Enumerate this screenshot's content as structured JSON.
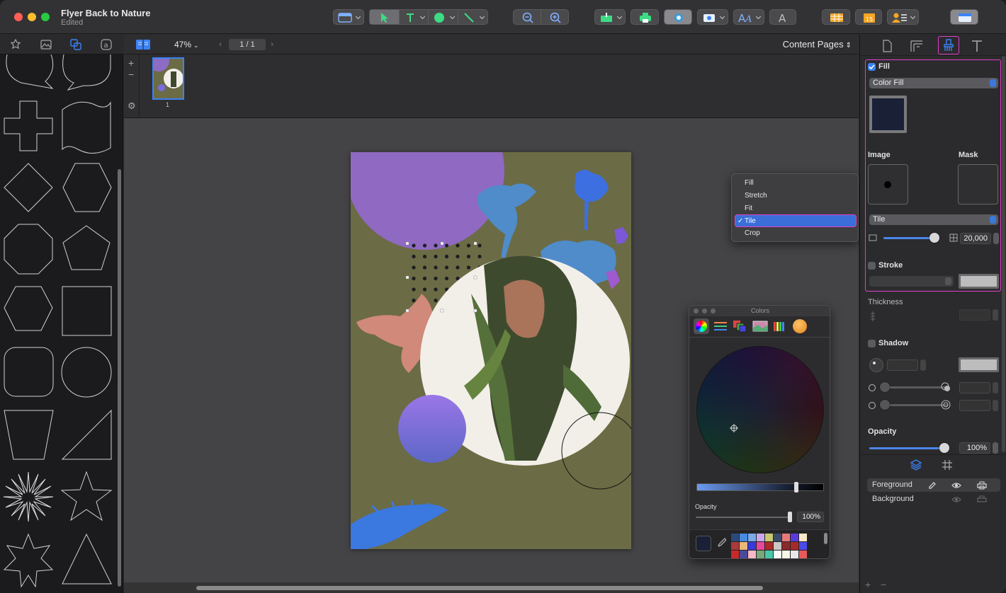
{
  "window": {
    "title": "Flyer Back to Nature",
    "subtitle": "Edited"
  },
  "navbar": {
    "zoom": "47%",
    "page_indicator": "1 / 1",
    "view_mode": "Content Pages"
  },
  "thumbnails": [
    {
      "label": "1"
    }
  ],
  "fit_menu": {
    "items": [
      "Fill",
      "Stretch",
      "Fit",
      "Tile",
      "Crop"
    ],
    "selected": "Tile",
    "checkmark": "✓"
  },
  "inspector": {
    "fill_label": "Fill",
    "fill_type": "Color Fill",
    "fill_color": "#1a2136",
    "image_label": "Image",
    "mask_label": "Mask",
    "image_mode": "Tile",
    "scale_value": "20,000",
    "stroke_label": "Stroke",
    "thickness_label": "Thickness",
    "shadow_label": "Shadow",
    "opacity_label": "Opacity",
    "opacity_value": "100%"
  },
  "layers": {
    "items": [
      {
        "name": "Foreground",
        "active": true
      },
      {
        "name": "Background",
        "active": false
      }
    ]
  },
  "colors_panel": {
    "title": "Colors",
    "opacity_label": "Opacity",
    "opacity_value": "100%"
  },
  "accent_colors": {
    "selection": "#e040c8",
    "accent": "#3b82f6",
    "page_bg": "#6b6b45"
  }
}
